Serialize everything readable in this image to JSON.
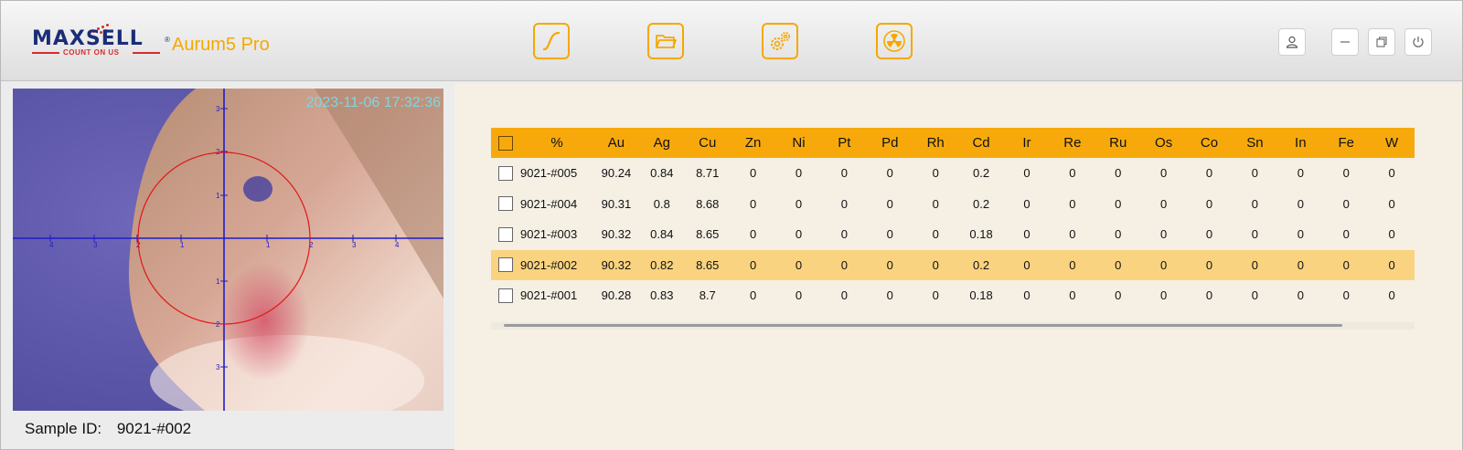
{
  "header": {
    "logo_text": "MAXSELL",
    "logo_registered": "®",
    "logo_tagline": "COUNT ON US",
    "app_name": "Aurum5 Pro",
    "toolbar": [
      {
        "name": "curve",
        "icon": "curve-icon"
      },
      {
        "name": "folder",
        "icon": "folder-icon"
      },
      {
        "name": "settings",
        "icon": "gears-icon"
      },
      {
        "name": "radiation",
        "icon": "radiation-icon"
      }
    ],
    "window_controls": [
      {
        "name": "user",
        "icon": "user-icon"
      },
      {
        "name": "minimize",
        "icon": "minimize-icon"
      },
      {
        "name": "restore",
        "icon": "restore-icon"
      },
      {
        "name": "power",
        "icon": "power-icon"
      }
    ]
  },
  "camera": {
    "timestamp": "2023-11-06 17:32:36",
    "x_ticks": [
      "4",
      "3",
      "2",
      "1",
      "1",
      "2",
      "3",
      "4"
    ],
    "y_ticks": [
      "3",
      "2",
      "1",
      "1",
      "2",
      "3"
    ]
  },
  "sample": {
    "label": "Sample ID:",
    "value": "9021-#002"
  },
  "table": {
    "columns": [
      "%",
      "Au",
      "Ag",
      "Cu",
      "Zn",
      "Ni",
      "Pt",
      "Pd",
      "Rh",
      "Cd",
      "Ir",
      "Re",
      "Ru",
      "Os",
      "Co",
      "Sn",
      "In",
      "Fe",
      "W"
    ],
    "rows": [
      {
        "id": "9021-#005",
        "values": [
          "90.24",
          "0.84",
          "8.71",
          "0",
          "0",
          "0",
          "0",
          "0",
          "0.2",
          "0",
          "0",
          "0",
          "0",
          "0",
          "0",
          "0",
          "0",
          "0"
        ],
        "selected": false
      },
      {
        "id": "9021-#004",
        "values": [
          "90.31",
          "0.8",
          "8.68",
          "0",
          "0",
          "0",
          "0",
          "0",
          "0.2",
          "0",
          "0",
          "0",
          "0",
          "0",
          "0",
          "0",
          "0",
          "0"
        ],
        "selected": false
      },
      {
        "id": "9021-#003",
        "values": [
          "90.32",
          "0.84",
          "8.65",
          "0",
          "0",
          "0",
          "0",
          "0",
          "0.18",
          "0",
          "0",
          "0",
          "0",
          "0",
          "0",
          "0",
          "0",
          "0"
        ],
        "selected": false
      },
      {
        "id": "9021-#002",
        "values": [
          "90.32",
          "0.82",
          "8.65",
          "0",
          "0",
          "0",
          "0",
          "0",
          "0.2",
          "0",
          "0",
          "0",
          "0",
          "0",
          "0",
          "0",
          "0",
          "0"
        ],
        "selected": true
      },
      {
        "id": "9021-#001",
        "values": [
          "90.28",
          "0.83",
          "8.7",
          "0",
          "0",
          "0",
          "0",
          "0",
          "0.18",
          "0",
          "0",
          "0",
          "0",
          "0",
          "0",
          "0",
          "0",
          "0"
        ],
        "selected": false
      }
    ]
  },
  "colors": {
    "accent": "#f5a800",
    "header_row": "#f7a90c",
    "selected_row": "#f9d37f",
    "panel_bg": "#f5efe4",
    "brand_blue": "#1b2d78",
    "brand_red": "#d72c2c"
  }
}
